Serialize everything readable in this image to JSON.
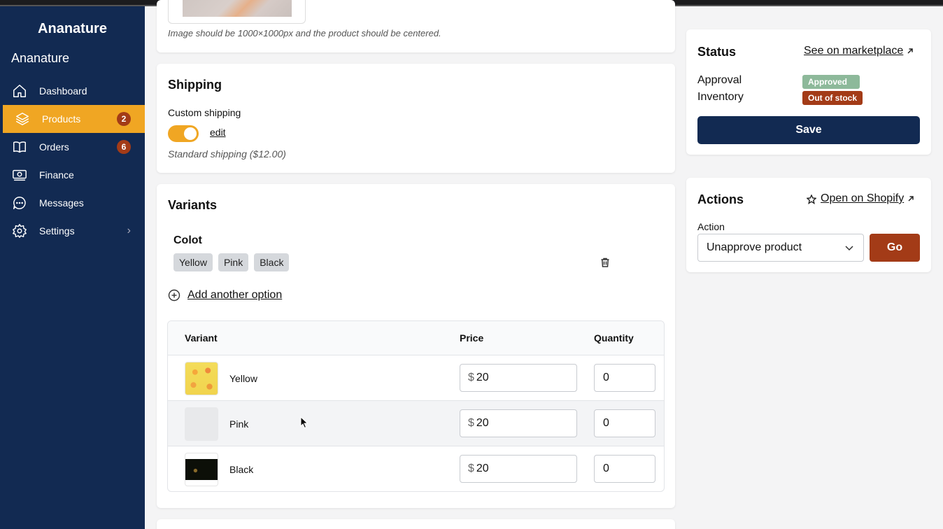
{
  "sidebar": {
    "brand": "Ananature",
    "store_name": "Ananature",
    "items": [
      {
        "label": "Dashboard",
        "icon": "home-icon"
      },
      {
        "label": "Products",
        "icon": "layers-icon",
        "badge": "2"
      },
      {
        "label": "Orders",
        "icon": "book-icon",
        "badge": "6"
      },
      {
        "label": "Finance",
        "icon": "money-icon"
      },
      {
        "label": "Messages",
        "icon": "chat-icon"
      },
      {
        "label": "Settings",
        "icon": "gear-icon"
      }
    ]
  },
  "image_section": {
    "hint": "Image should be 1000×1000px and the product should be centered."
  },
  "shipping": {
    "title": "Shipping",
    "custom_label": "Custom shipping",
    "edit_label": "edit",
    "standard": "Standard shipping ($12.00)"
  },
  "variants": {
    "title": "Variants",
    "option_name": "Colot",
    "option_values": [
      "Yellow",
      "Pink",
      "Black"
    ],
    "add_option_label": "Add another option",
    "table": {
      "headers": {
        "variant": "Variant",
        "price": "Price",
        "quantity": "Quantity"
      },
      "rows": [
        {
          "name": "Yellow",
          "currency": "$",
          "price": "20",
          "quantity": "0"
        },
        {
          "name": "Pink",
          "currency": "$",
          "price": "20",
          "quantity": "0"
        },
        {
          "name": "Black",
          "currency": "$",
          "price": "20",
          "quantity": "0"
        }
      ]
    }
  },
  "status": {
    "title": "Status",
    "marketplace_link": "See on marketplace",
    "approval_label": "Approval",
    "approval_value": "Approved",
    "inventory_label": "Inventory",
    "inventory_value": "Out of stock",
    "save_label": "Save"
  },
  "actions": {
    "title": "Actions",
    "shopify_link": "Open on Shopify",
    "action_label": "Action",
    "selected_action": "Unapprove product",
    "go_label": "Go"
  },
  "colors": {
    "sidebar_bg": "#122a52",
    "accent": "#f0a623",
    "danger": "#a33b17",
    "approved": "#8db99a"
  }
}
